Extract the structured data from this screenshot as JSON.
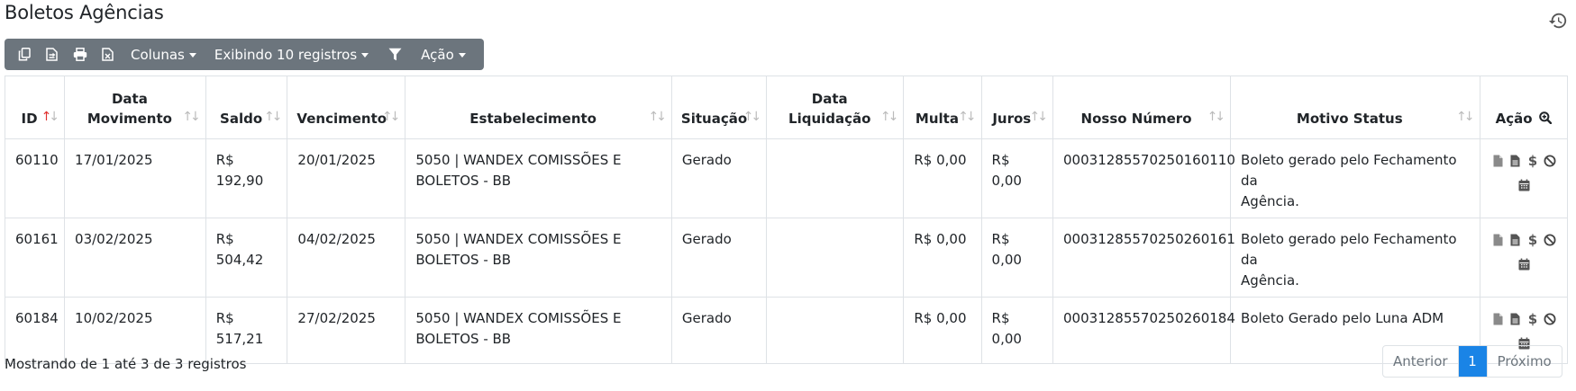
{
  "page": {
    "title": "Boletos Agências"
  },
  "toolbar": {
    "columns_label": "Colunas",
    "display_label": "Exibindo 10 registros",
    "action_label": "Ação"
  },
  "table": {
    "headers": {
      "id": "ID",
      "data_movimento_line1": "Data",
      "data_movimento_line2": "Movimento",
      "saldo": "Saldo",
      "vencimento": "Vencimento",
      "estabelecimento": "Estabelecimento",
      "situacao": "Situação",
      "data_liquidacao_line1": "Data",
      "data_liquidacao_line2": "Liquidação",
      "multa": "Multa",
      "juros": "Juros",
      "nosso_numero": "Nosso Número",
      "motivo_status": "Motivo Status",
      "acao": "Ação"
    },
    "rows": [
      {
        "id": "60110",
        "data_movimento": "17/01/2025",
        "saldo_line1": "R$",
        "saldo_line2": "192,90",
        "vencimento": "20/01/2025",
        "estabelecimento_line1": "5050 | WANDEX COMISSÕES E",
        "estabelecimento_line2": "BOLETOS - BB",
        "situacao": "Gerado",
        "data_liquidacao": "",
        "multa": "R$ 0,00",
        "juros": "R$ 0,00",
        "nosso_numero": "00031285570250160110",
        "motivo_line1": "Boleto gerado pelo Fechamento da",
        "motivo_line2": "Agência."
      },
      {
        "id": "60161",
        "data_movimento": "03/02/2025",
        "saldo_line1": "R$",
        "saldo_line2": "504,42",
        "vencimento": "04/02/2025",
        "estabelecimento_line1": "5050 | WANDEX COMISSÕES E",
        "estabelecimento_line2": "BOLETOS - BB",
        "situacao": "Gerado",
        "data_liquidacao": "",
        "multa": "R$ 0,00",
        "juros": "R$ 0,00",
        "nosso_numero": "00031285570250260161",
        "motivo_line1": "Boleto gerado pelo Fechamento da",
        "motivo_line2": "Agência."
      },
      {
        "id": "60184",
        "data_movimento": "10/02/2025",
        "saldo_line1": "R$",
        "saldo_line2": "517,21",
        "vencimento": "27/02/2025",
        "estabelecimento_line1": "5050 | WANDEX COMISSÕES E",
        "estabelecimento_line2": "BOLETOS - BB",
        "situacao": "Gerado",
        "data_liquidacao": "",
        "multa": "R$ 0,00",
        "juros": "R$ 0,00",
        "nosso_numero": "00031285570250260184",
        "motivo_line1": "Boleto Gerado pelo Luna ADM",
        "motivo_line2": ""
      }
    ]
  },
  "footer": {
    "info": "Mostrando de 1 até 3 de 3 registros",
    "prev_label": "Anterior",
    "current_page": "1",
    "next_label": "Próximo"
  },
  "icons": {
    "toolbar": [
      "copy-icon",
      "csv-icon",
      "print-icon",
      "excel-icon",
      "filter-icon"
    ],
    "header": [
      "history-icon",
      "search-plus-icon"
    ],
    "row": [
      "file-icon",
      "file-text-icon",
      "dollar-icon",
      "ban-icon",
      "calendar-icon"
    ]
  },
  "colors": {
    "toolbar_bg": "#6c757d",
    "active_page": "#1a84e6",
    "sort_active": "#e0302f"
  }
}
